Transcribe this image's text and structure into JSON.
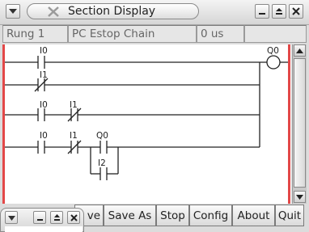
{
  "window": {
    "title": "Section Display",
    "icons": [
      "window-menu-icon",
      "close-x-icon",
      "minimize-icon",
      "maximize-icon",
      "close-icon"
    ]
  },
  "status": {
    "rung": "Rung 1",
    "comment": "PC Estop Chain",
    "time": "0 us"
  },
  "rungs": {
    "r1": {
      "contact": "I0",
      "coil": "Q0"
    },
    "r2": {
      "contact": "I1"
    },
    "r3": {
      "contact_a": "I0",
      "contact_b": "I1"
    },
    "r4": {
      "contact_a": "I0",
      "contact_b": "I1",
      "contact_c": "Q0",
      "parallel": "I2"
    }
  },
  "buttons": {
    "save": "ve",
    "save_as": "Save As",
    "stop": "Stop",
    "config": "Config",
    "about": "About",
    "quit": "Quit"
  },
  "mini_window": {
    "icons": [
      "window-menu-icon",
      "minimize-icon",
      "maximize-icon",
      "close-icon"
    ]
  }
}
